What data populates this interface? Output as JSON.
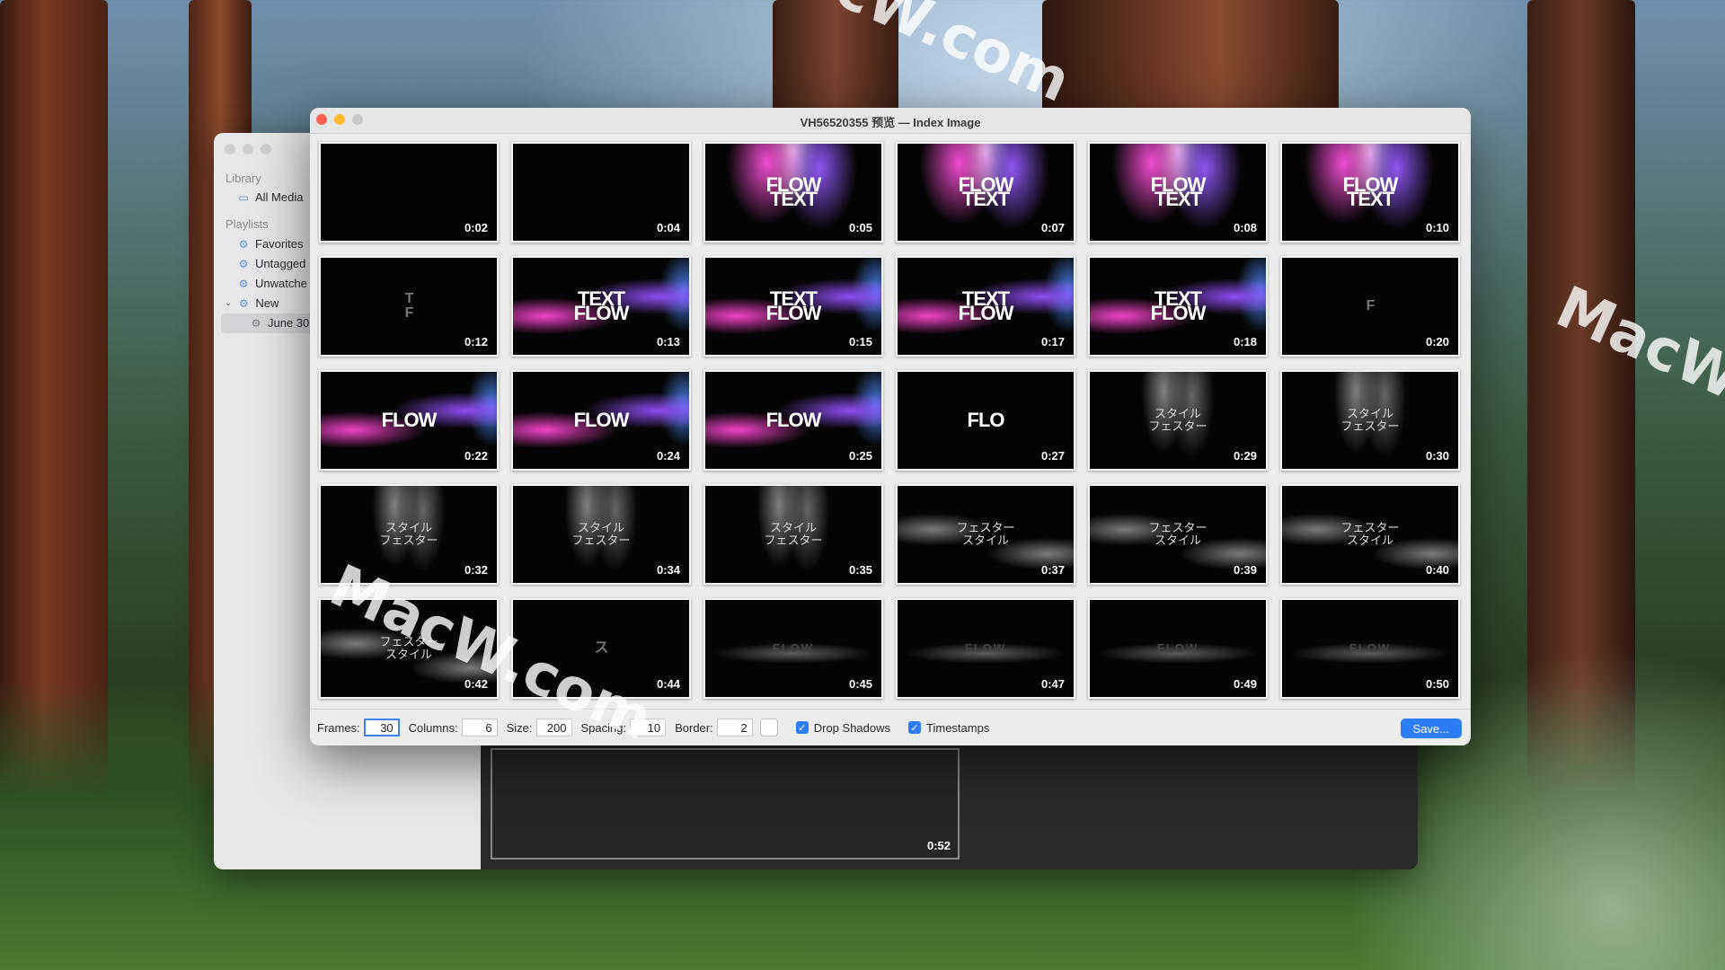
{
  "window": {
    "title": "VH56520355 预览 — Index Image"
  },
  "sidebar": {
    "library_heading": "Library",
    "library_items": [
      {
        "label": "All Media",
        "icon": "archive-icon"
      }
    ],
    "playlists_heading": "Playlists",
    "playlist_items": [
      {
        "label": "Favorites",
        "icon": "gear-icon"
      },
      {
        "label": "Untagged",
        "icon": "gear-icon"
      },
      {
        "label": "Unwatche",
        "icon": "gear-icon"
      },
      {
        "label": "New",
        "icon": "gear-icon",
        "expanded": true
      },
      {
        "label": "June 30",
        "icon": "gear-icon",
        "selected": true
      }
    ]
  },
  "background_window": {
    "visible_thumb_time": "0:52"
  },
  "thumbnails": [
    {
      "time": "0:02",
      "text": ""
    },
    {
      "time": "0:04",
      "text": ""
    },
    {
      "time": "0:05",
      "text": "FLOW\nTEXT"
    },
    {
      "time": "0:07",
      "text": "FLOW\nTEXT"
    },
    {
      "time": "0:08",
      "text": "FLOW\nTEXT"
    },
    {
      "time": "0:10",
      "text": "FLOW\nTEXT"
    },
    {
      "time": "0:12",
      "text": "T\nF"
    },
    {
      "time": "0:13",
      "text": "TEXT\nFLOW"
    },
    {
      "time": "0:15",
      "text": "TEXT\nFLOW"
    },
    {
      "time": "0:17",
      "text": "TEXT\nFLOW"
    },
    {
      "time": "0:18",
      "text": "TEXT\nFLOW"
    },
    {
      "time": "0:20",
      "text": "F"
    },
    {
      "time": "0:22",
      "text": "FLOW"
    },
    {
      "time": "0:24",
      "text": "FLOW"
    },
    {
      "time": "0:25",
      "text": "FLOW"
    },
    {
      "time": "0:27",
      "text": "FLO"
    },
    {
      "time": "0:29",
      "text": "スタイル\nフェスター"
    },
    {
      "time": "0:30",
      "text": "スタイル\nフェスター"
    },
    {
      "time": "0:32",
      "text": "スタイル\nフェスター"
    },
    {
      "time": "0:34",
      "text": "スタイル\nフェスター"
    },
    {
      "time": "0:35",
      "text": "スタイル\nフェスター"
    },
    {
      "time": "0:37",
      "text": "フェスター\nスタイル"
    },
    {
      "time": "0:39",
      "text": "フェスター\nスタイル"
    },
    {
      "time": "0:40",
      "text": "フェスター\nスタイル"
    },
    {
      "time": "0:42",
      "text": "フェスター\nスタイル"
    },
    {
      "time": "0:44",
      "text": "ス"
    },
    {
      "time": "0:45",
      "text": "FLOW"
    },
    {
      "time": "0:47",
      "text": "FLOW"
    },
    {
      "time": "0:49",
      "text": "FLOW"
    },
    {
      "time": "0:50",
      "text": "FLOW"
    }
  ],
  "toolbar": {
    "frames_label": "Frames:",
    "frames_value": "30",
    "columns_label": "Columns:",
    "columns_value": "6",
    "size_label": "Size:",
    "size_value": "200",
    "spacing_label": "Spacing:",
    "spacing_value": "10",
    "border_label": "Border:",
    "border_value": "2",
    "drop_shadows_label": "Drop Shadows",
    "drop_shadows_checked": true,
    "timestamps_label": "Timestamps",
    "timestamps_checked": true,
    "save_label": "Save..."
  },
  "watermarks": [
    "MacW.com",
    "MacW.com",
    "MacW.com"
  ],
  "colors": {
    "accent": "#2e7cf6",
    "close": "#fe5f57",
    "minimize": "#febc2e"
  }
}
